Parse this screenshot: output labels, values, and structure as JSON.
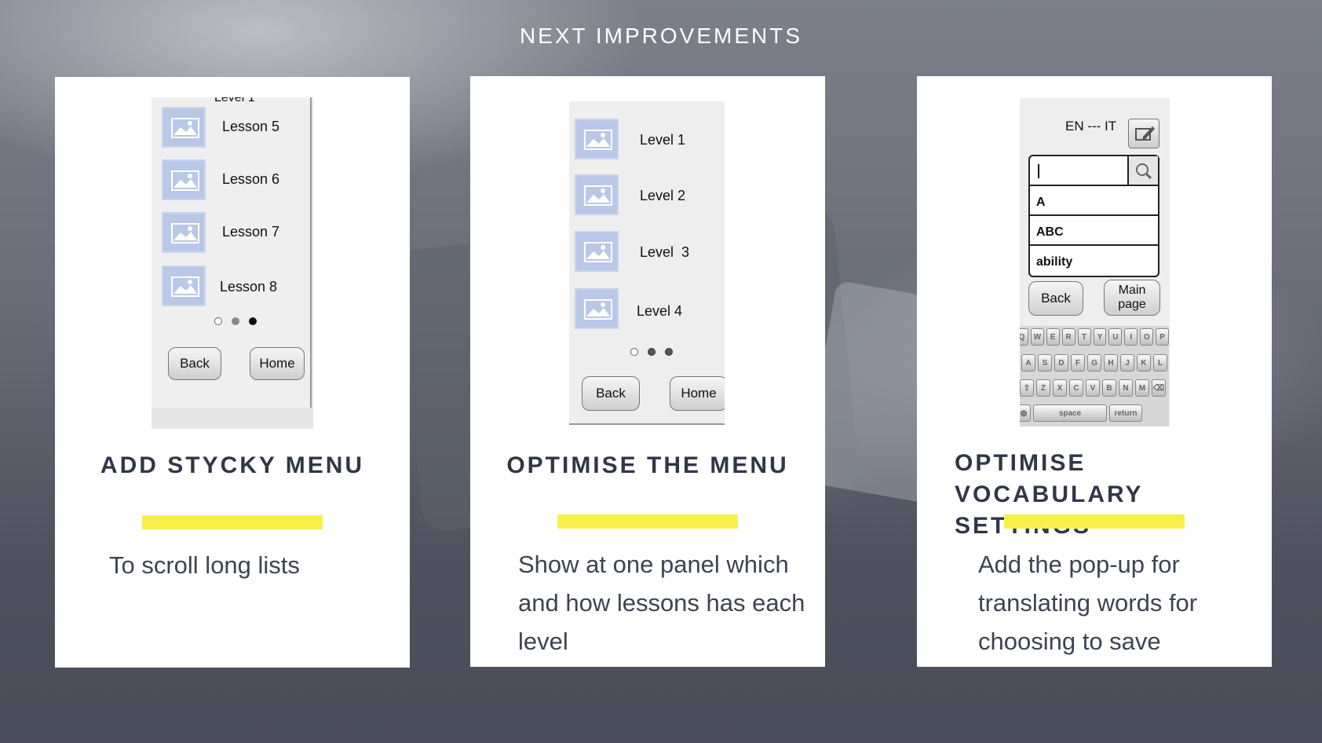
{
  "page_title": "NEXT IMPROVEMENTS",
  "colors": {
    "accent_bar": "#f8f04a",
    "heading": "#303746",
    "card": "#ffffff"
  },
  "cards": [
    {
      "heading": "ADD STYCKY MENU",
      "body": "To scroll long lists",
      "screenshot": {
        "top_label": "Level 1",
        "items": [
          "Lesson 5",
          "Lesson 6",
          "Lesson 7",
          "Lesson 8"
        ],
        "back": "Back",
        "home": "Home",
        "page_dots": 3,
        "active_dot": 3
      }
    },
    {
      "heading": "OPTIMISE THE MENU",
      "body": "Show at one panel which and how lessons has each level",
      "screenshot": {
        "items": [
          "Level 1",
          "Level 2",
          "Level  3",
          "Level 4"
        ],
        "back": "Back",
        "home": "Home",
        "page_dots": 3
      }
    },
    {
      "heading": "OPTIMISE VOCABULARY SETTINGS",
      "body": "Add the pop-up for translating words for choosing to save",
      "screenshot": {
        "lang": "EN --- IT",
        "suggestions": [
          "A",
          "ABC",
          "ability"
        ],
        "back": "Back",
        "main_page": "Main page",
        "keyboard_rows": [
          [
            "Q",
            "W",
            "E",
            "R",
            "T",
            "Y",
            "U",
            "I",
            "O",
            "P"
          ],
          [
            "A",
            "S",
            "D",
            "F",
            "G",
            "H",
            "J",
            "K",
            "L"
          ],
          [
            "⇧",
            "Z",
            "X",
            "C",
            "V",
            "B",
            "N",
            "M",
            "⌫"
          ]
        ],
        "space": "space",
        "return": "return"
      }
    }
  ]
}
